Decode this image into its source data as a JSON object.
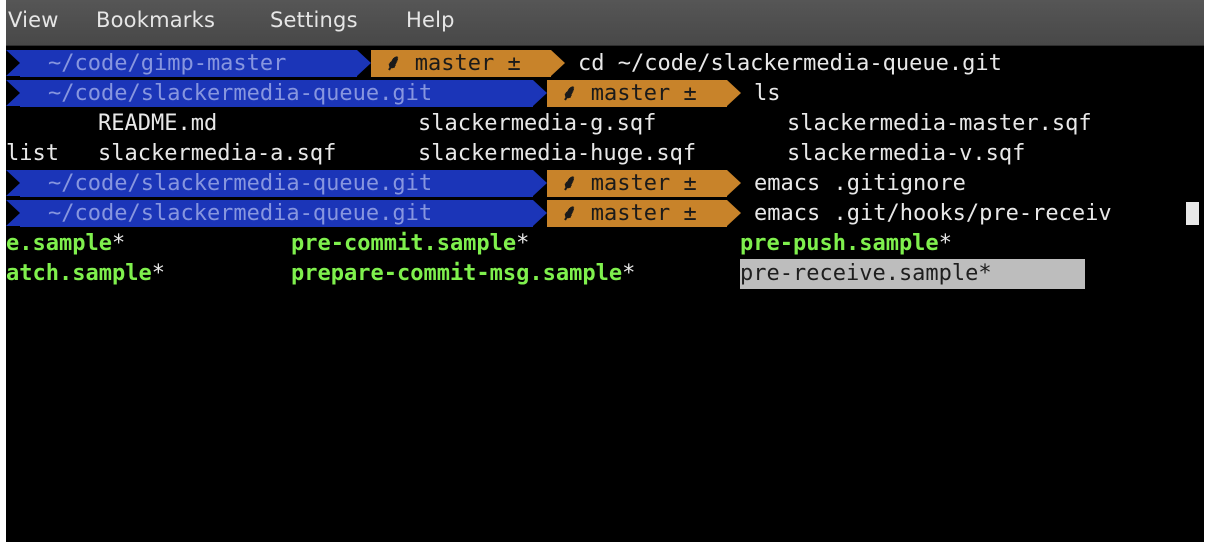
{
  "menubar": {
    "items": [
      "View",
      "Bookmarks",
      "Settings",
      "Help"
    ]
  },
  "terminal": {
    "prompts": [
      {
        "dir": "~/code/gimp-master",
        "branch_icon": "⸙",
        "branch": "master",
        "status": "±",
        "command": "cd ~/code/slackermedia-queue.git"
      },
      {
        "dir": "~/code/slackermedia-queue.git",
        "branch_icon": "⸙",
        "branch": "master",
        "status": "±",
        "command": "ls"
      },
      {
        "dir": "~/code/slackermedia-queue.git",
        "branch_icon": "⸙",
        "branch": "master",
        "status": "±",
        "command": "emacs .gitignore"
      },
      {
        "dir": "~/code/slackermedia-queue.git",
        "branch_icon": "⸙",
        "branch": "master",
        "status": "±",
        "command": "emacs .git/hooks/pre-receiv"
      }
    ],
    "ls_output": {
      "row1": [
        "README.md",
        "slackermedia-g.sqf",
        "slackermedia-master.sqf"
      ],
      "row2": [
        "list",
        "slackermedia-a.sqf",
        "slackermedia-huge.sqf",
        "slackermedia-v.sqf"
      ]
    },
    "completions": {
      "row1": [
        {
          "name": "e.sample",
          "mark": "*"
        },
        {
          "name": "pre-commit.sample",
          "mark": "*"
        },
        {
          "name": "pre-push.sample",
          "mark": "*"
        }
      ],
      "row2": [
        {
          "name": "atch.sample",
          "mark": "*"
        },
        {
          "name": "prepare-commit-msg.sample",
          "mark": "*"
        }
      ],
      "selected": "pre-receive.sample*"
    }
  },
  "colors": {
    "dir_segment": "#1b35b8",
    "git_segment": "#c8832a",
    "executable": "#7ff04d",
    "selection": "#bdbdbd"
  }
}
